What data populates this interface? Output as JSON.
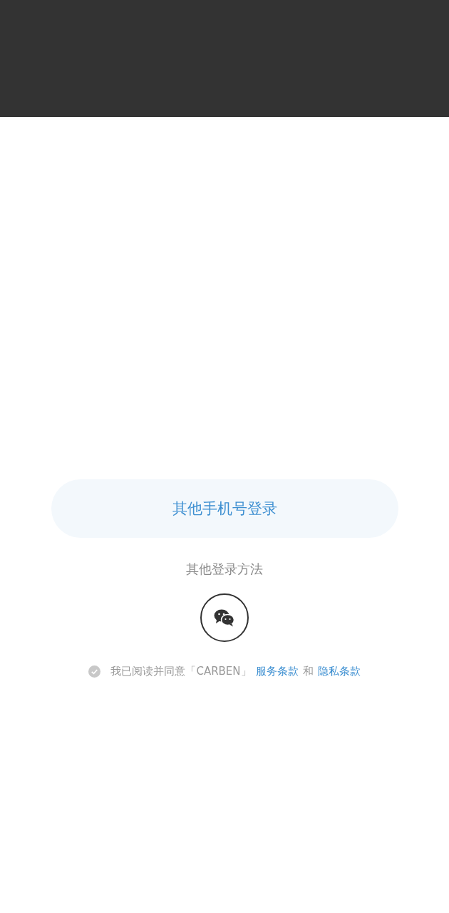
{
  "phone_login_button": "其他手机号登录",
  "other_methods_label": "其他登录方法",
  "agreement": {
    "checked": false,
    "text": "我已阅读并同意「CARBEN」",
    "terms_link": "服务条款",
    "conjunction": "和",
    "privacy_link": "隐私条款"
  }
}
